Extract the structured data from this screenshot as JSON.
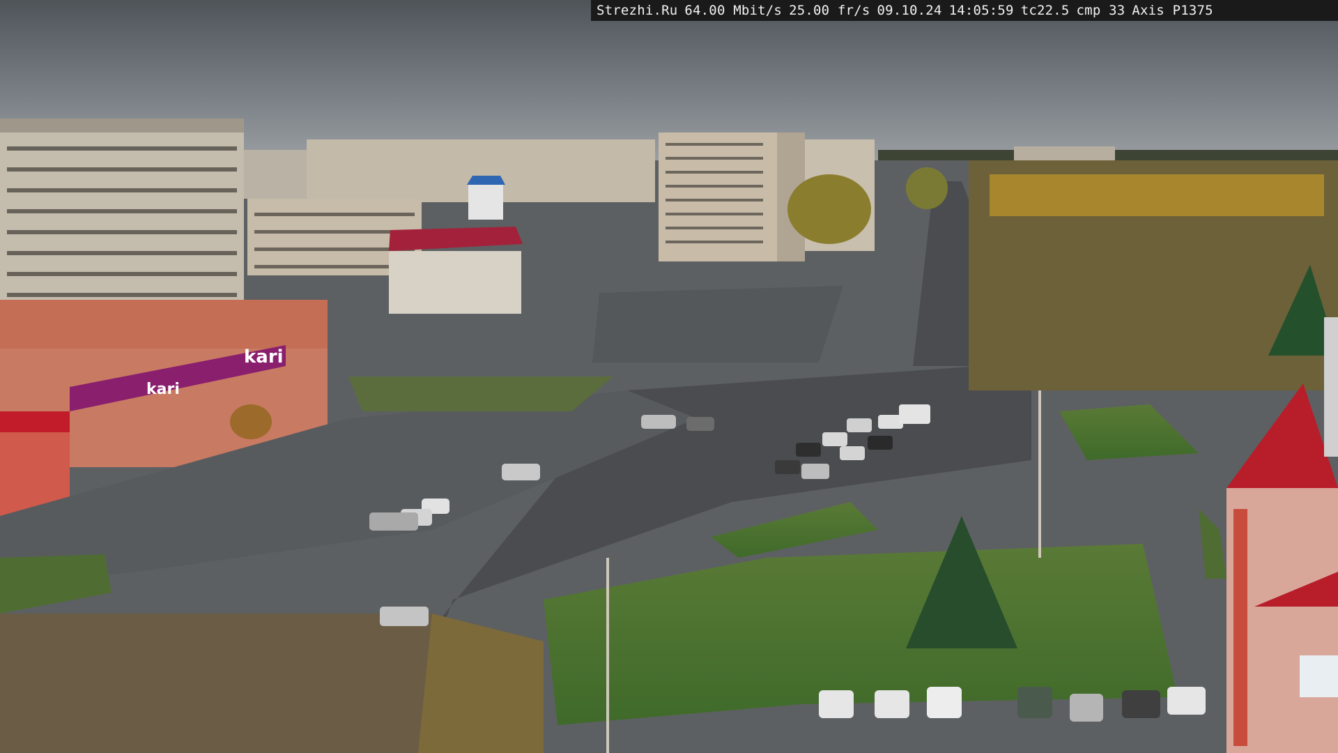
{
  "overlay": {
    "site": "Strezhi.Ru",
    "bitrate": "64.00 Mbit/s",
    "framerate": "25.00 fr/s",
    "date": "09.10.24",
    "time": "14:05:59",
    "tc": "tc22.5",
    "cmp": "cmp 33",
    "camera": "Axis P1375"
  },
  "signage": {
    "kari_main": "kari",
    "kari_banner": "kari"
  },
  "colors": {
    "sky": "#6f7479",
    "road": "#4a4c4f",
    "grass": "#4f7a2f",
    "brick": "#c8705a",
    "kari_purple": "#8a1f6e",
    "red_roof": "#b81d2a"
  }
}
